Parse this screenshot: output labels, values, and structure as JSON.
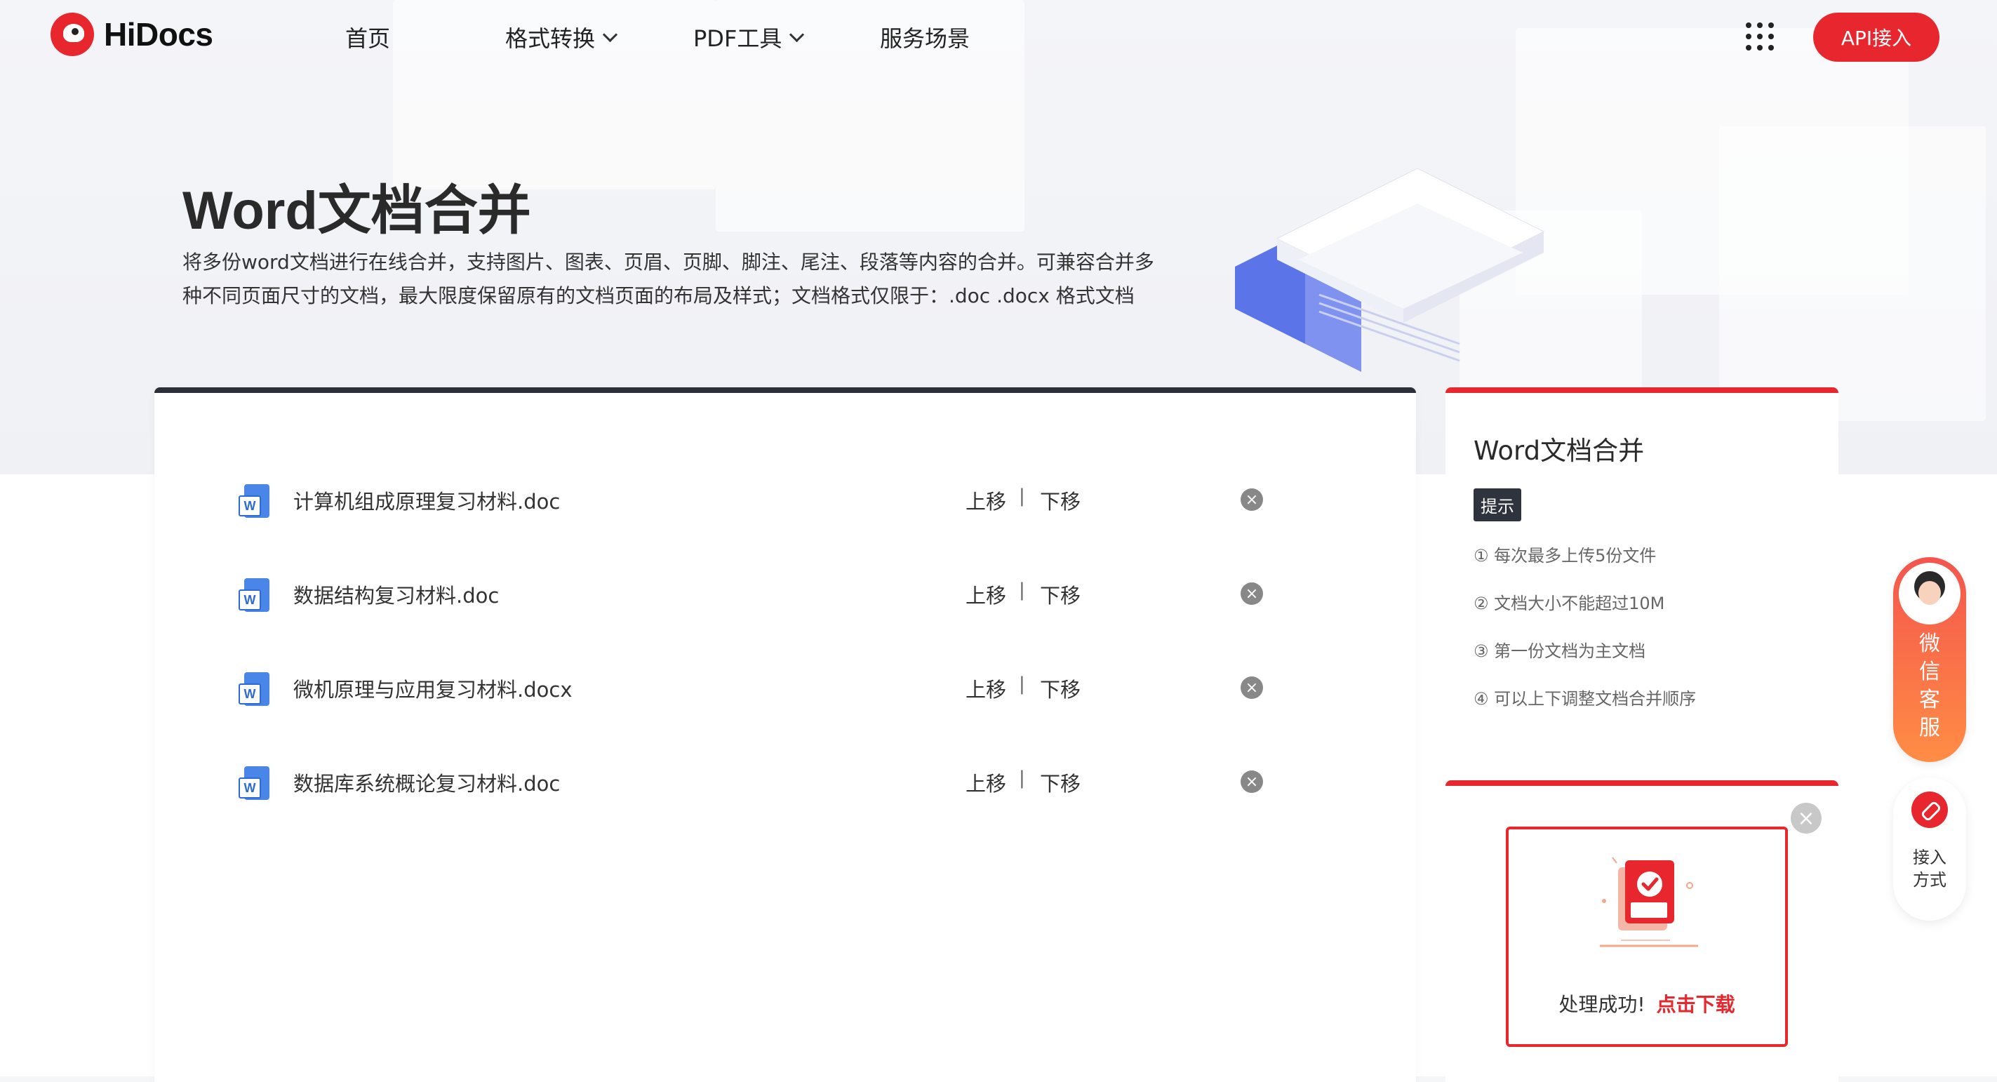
{
  "brand": {
    "name": "HiDocs",
    "accent": "#e8262d"
  },
  "nav": {
    "items": [
      {
        "label": "首页"
      },
      {
        "label": "格式转换"
      },
      {
        "label": "PDF工具"
      },
      {
        "label": "服务场景"
      }
    ],
    "api_button": "API接入",
    "apps_icon": "grid-dots-icon"
  },
  "hero": {
    "title": "Word文档合并",
    "description_line1": "将多份word文档进行在线合并，支持图片、图表、页眉、页脚、脚注、尾注、段落等内容的合并。可兼容合并多",
    "description_line2": "种不同页面尺寸的文档，最大限度保留原有的文档页面的布局及样式；文档格式仅限于：.doc .docx 格式文档"
  },
  "files": [
    {
      "name": "计算机组成原理复习材料.doc",
      "up": "上移",
      "sep": "|",
      "down": "下移"
    },
    {
      "name": "数据结构复习材料.doc",
      "up": "上移",
      "sep": "|",
      "down": "下移"
    },
    {
      "name": "微机原理与应用复习材料.docx",
      "up": "上移",
      "sep": "|",
      "down": "下移"
    },
    {
      "name": "数据库系统概论复习材料.doc",
      "up": "上移",
      "sep": "|",
      "down": "下移"
    }
  ],
  "file_icon_letter": "W",
  "tips_card": {
    "title": "Word文档合并",
    "badge": "提示",
    "items": [
      "① 每次最多上传5份文件",
      "② 文档大小不能超过10M",
      "③ 第一份文档为主文档",
      "④ 可以上下调整文档合并顺序"
    ]
  },
  "download_card": {
    "status": "处理成功!",
    "link": "点击下载",
    "close": "×"
  },
  "float": {
    "wechat": [
      "微",
      "信",
      "客",
      "服"
    ],
    "access_line1": "接入",
    "access_line2": "方式"
  }
}
